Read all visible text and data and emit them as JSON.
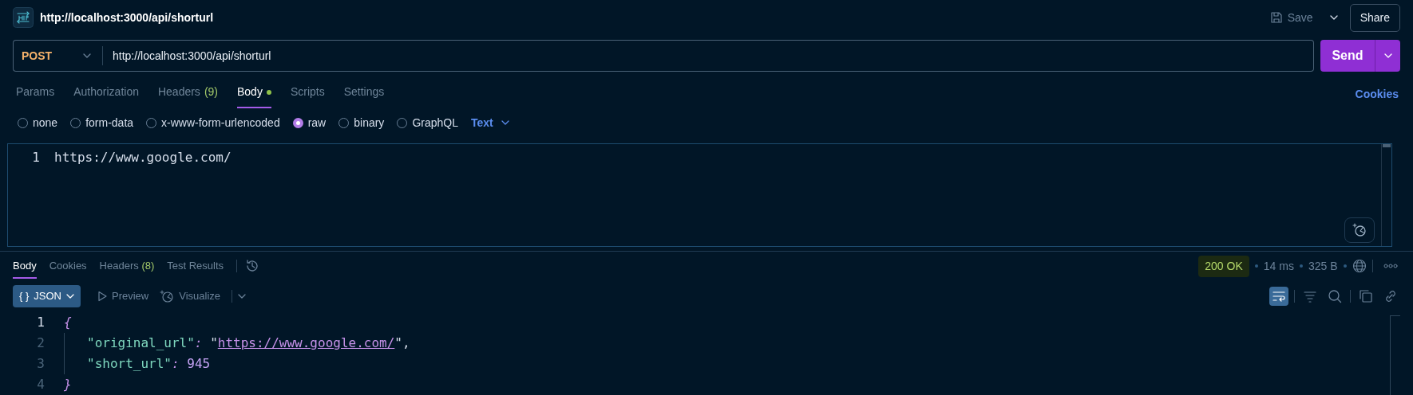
{
  "request": {
    "title": "http://localhost:3000/api/shorturl",
    "save_label": "Save",
    "share_label": "Share",
    "method": "POST",
    "url": "http://localhost:3000/api/shorturl",
    "send_label": "Send"
  },
  "request_tabs": [
    {
      "label": "Params",
      "selected": false
    },
    {
      "label": "Authorization",
      "selected": false
    },
    {
      "label": "Headers",
      "count": "(9)",
      "selected": false
    },
    {
      "label": "Body",
      "selected": true,
      "dot": true
    },
    {
      "label": "Scripts",
      "selected": false
    },
    {
      "label": "Settings",
      "selected": false
    }
  ],
  "cookies_link": "Cookies",
  "body_types": [
    {
      "label": "none",
      "selected": false
    },
    {
      "label": "form-data",
      "selected": false
    },
    {
      "label": "x-www-form-urlencoded",
      "selected": false
    },
    {
      "label": "raw",
      "selected": true
    },
    {
      "label": "binary",
      "selected": false
    },
    {
      "label": "GraphQL",
      "selected": false
    }
  ],
  "body_format": "Text",
  "request_body": [
    {
      "number": "1",
      "text": "https://www.google.com/"
    }
  ],
  "response_tabs": [
    {
      "label": "Body",
      "selected": true
    },
    {
      "label": "Cookies",
      "selected": false
    },
    {
      "label": "Headers",
      "count": "(8)",
      "selected": false
    },
    {
      "label": "Test Results",
      "selected": false
    }
  ],
  "status": "200 OK",
  "time": "14 ms",
  "size": "325 B",
  "view_modes": [
    {
      "kind": "dropdown",
      "glyph": "{ }",
      "label": "JSON",
      "selected": true
    },
    {
      "kind": "preview",
      "label": "Preview",
      "selected": false
    },
    {
      "kind": "visualize",
      "label": "Visualize",
      "selected": false
    }
  ],
  "wrap_lines": true,
  "response_body": [
    {
      "number": "1",
      "active": true,
      "tokens": [
        {
          "kind": "brace",
          "text": "{"
        }
      ]
    },
    {
      "number": "2",
      "active": false,
      "tokens": [
        {
          "kind": "key",
          "text": "\"original_url\""
        },
        {
          "kind": "colon",
          "text": ":"
        },
        {
          "kind": "punct",
          "text": " \""
        },
        {
          "kind": "link",
          "text": "https://www.google.com/"
        },
        {
          "kind": "punct",
          "text": "\","
        }
      ]
    },
    {
      "number": "3",
      "active": false,
      "tokens": [
        {
          "kind": "key",
          "text": "\"short_url\""
        },
        {
          "kind": "colon",
          "text": ":"
        },
        {
          "kind": "number",
          "text": " 945"
        }
      ]
    },
    {
      "number": "4",
      "active": false,
      "tokens": [
        {
          "kind": "brace",
          "text": "}"
        }
      ]
    }
  ]
}
